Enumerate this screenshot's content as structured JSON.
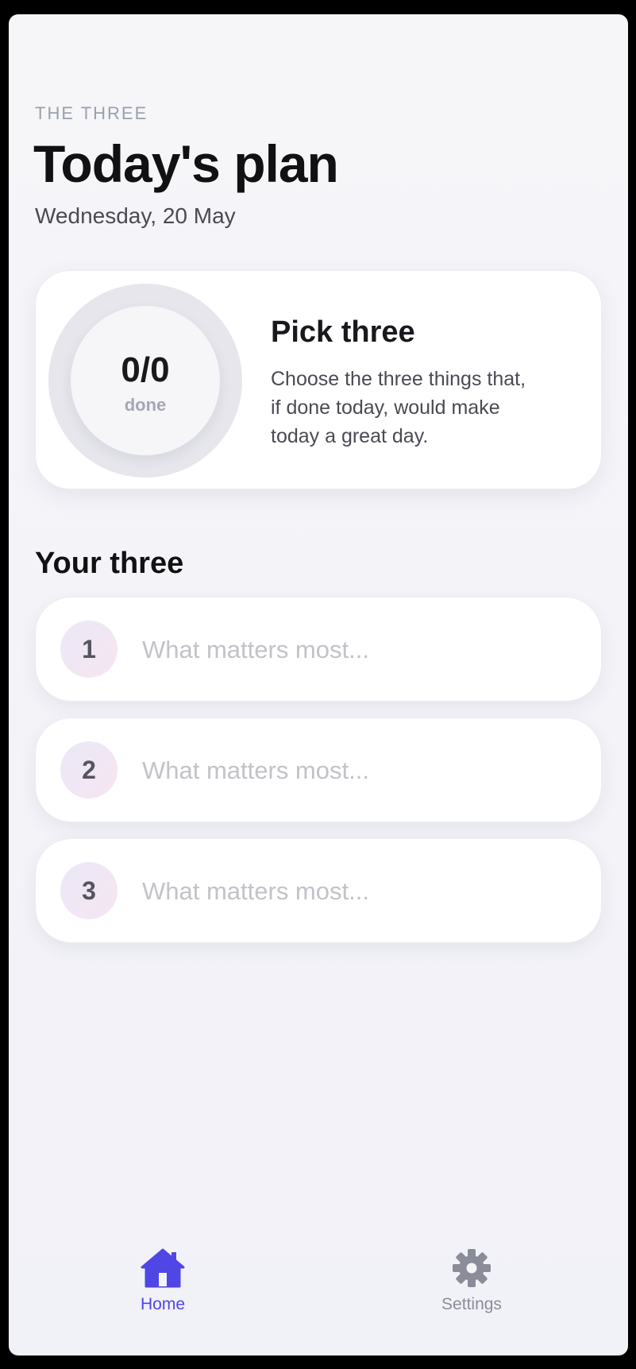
{
  "header": {
    "eyebrow": "THE THREE",
    "title": "Today's plan",
    "date": "Wednesday, 20 May"
  },
  "summary": {
    "count_text": "0/0",
    "done_label": "done",
    "completed": 0,
    "total": 0,
    "title": "Pick three",
    "body": "Choose the three things that, if done today, would make today a great day."
  },
  "tasks_section": {
    "title": "Your three",
    "items": [
      {
        "number": "1",
        "value": "",
        "placeholder": "What matters most..."
      },
      {
        "number": "2",
        "value": "",
        "placeholder": "What matters most..."
      },
      {
        "number": "3",
        "value": "",
        "placeholder": "What matters most..."
      }
    ]
  },
  "tabbar": {
    "home_label": "Home",
    "home_icon": "home-icon",
    "settings_label": "Settings",
    "settings_icon": "gear-icon",
    "active": "home"
  },
  "colors": {
    "accent": "#4f46e5",
    "inactive": "#8a8d99",
    "ring_track": "#e6e6ec"
  }
}
